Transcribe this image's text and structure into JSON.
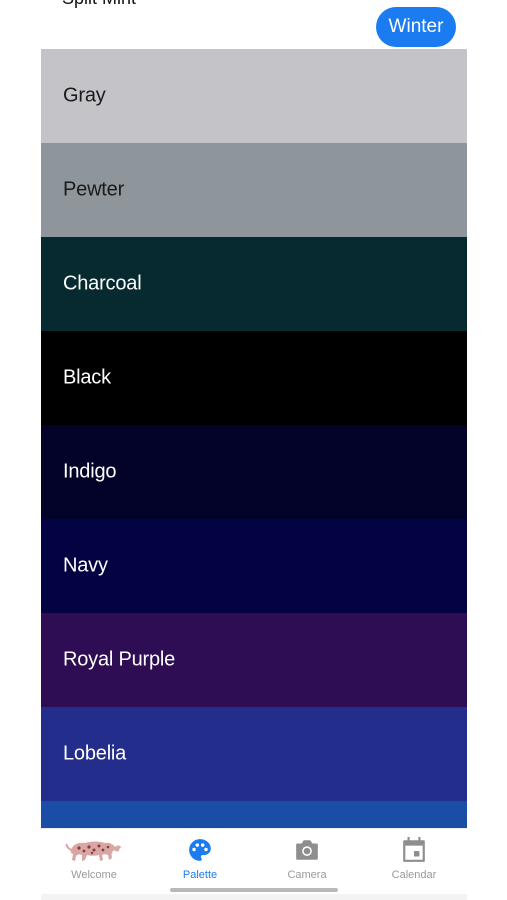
{
  "header": {
    "partial_title": "Split Mint",
    "season_button": "Winter"
  },
  "palette": [
    {
      "name": "Gray",
      "color": "#c4c4c8",
      "text_color": "#1a1a1a"
    },
    {
      "name": "Pewter",
      "color": "#8f969b",
      "text_color": "#1a1a1a"
    },
    {
      "name": "Charcoal",
      "color": "#062a2f",
      "text_color": "#ffffff"
    },
    {
      "name": "Black",
      "color": "#000000",
      "text_color": "#ffffff"
    },
    {
      "name": "Indigo",
      "color": "#03032a",
      "text_color": "#ffffff"
    },
    {
      "name": "Navy",
      "color": "#030343",
      "text_color": "#ffffff"
    },
    {
      "name": "Royal Purple",
      "color": "#2e0d54",
      "text_color": "#ffffff"
    },
    {
      "name": "Lobelia",
      "color": "#232d8c",
      "text_color": "#ffffff"
    },
    {
      "name": "",
      "color": "#1a4ea6",
      "text_color": "#ffffff"
    }
  ],
  "tabbar": {
    "tabs": [
      {
        "label": "Welcome",
        "icon": "leopard-icon",
        "active": false
      },
      {
        "label": "Palette",
        "icon": "palette-icon",
        "active": true
      },
      {
        "label": "Camera",
        "icon": "camera-icon",
        "active": false
      },
      {
        "label": "Calendar",
        "icon": "calendar-icon",
        "active": false
      }
    ]
  },
  "colors": {
    "accent": "#1a7cf0",
    "inactive": "#9a9a9a"
  }
}
